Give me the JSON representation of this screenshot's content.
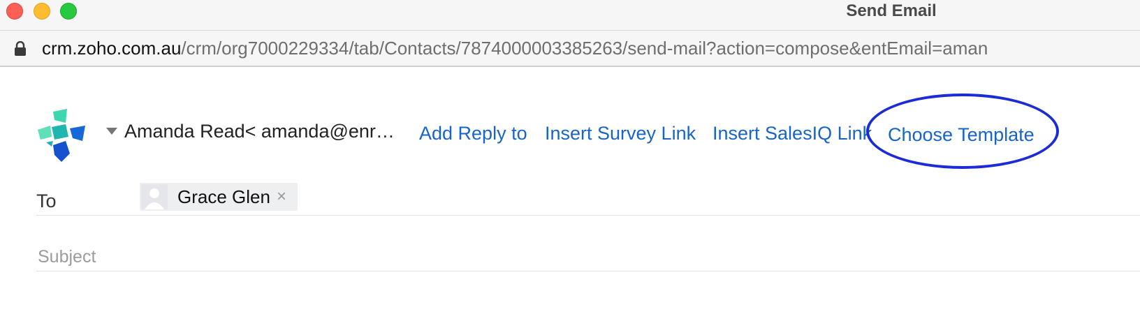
{
  "window": {
    "title": "Send Email",
    "controls": [
      "close",
      "minimize",
      "zoom"
    ]
  },
  "address_bar": {
    "host": "crm.zoho.com.au",
    "path": "/crm/org7000229334/tab/Contacts/7874000003385263/send-mail?action=compose&entEmail=aman"
  },
  "compose": {
    "from": "Amanda Read< amanda@enr…",
    "links": {
      "add_reply_to": "Add Reply to",
      "insert_survey_link": "Insert Survey Link",
      "insert_salesiq_link": "Insert SalesIQ Link",
      "choose_template": "Choose Template"
    },
    "to_label": "To",
    "recipients": [
      {
        "name": "Grace Glen",
        "remove_symbol": "×"
      }
    ],
    "subject_placeholder": "Subject",
    "subject_value": ""
  },
  "icons": {
    "lock": "lock-icon",
    "logo": "zoho-crm-logo-icon",
    "caret": "caret-down-icon",
    "avatar": "avatar-icon",
    "remove": "close-icon"
  },
  "colors": {
    "link": "#1765c8",
    "highlight_ring": "#1c2bd8",
    "traffic_red": "#fe5f57",
    "traffic_yellow": "#febc2e",
    "traffic_green": "#28c840"
  }
}
